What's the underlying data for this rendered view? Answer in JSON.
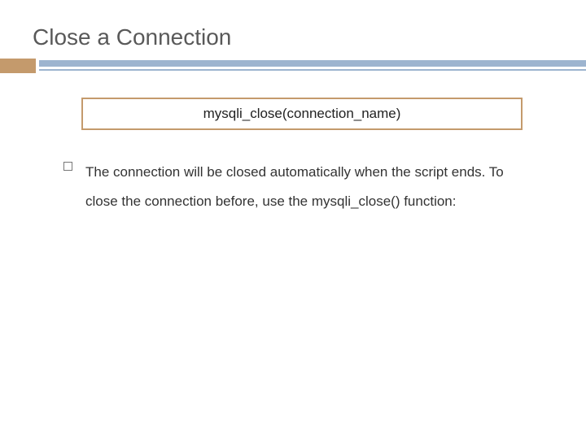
{
  "slide": {
    "title": "Close a Connection",
    "code_box": "mysqli_close(connection_name)",
    "bullets": [
      "The connection will be closed automatically when the script ends. To close the connection before, use the mysqli_close() function:"
    ]
  }
}
